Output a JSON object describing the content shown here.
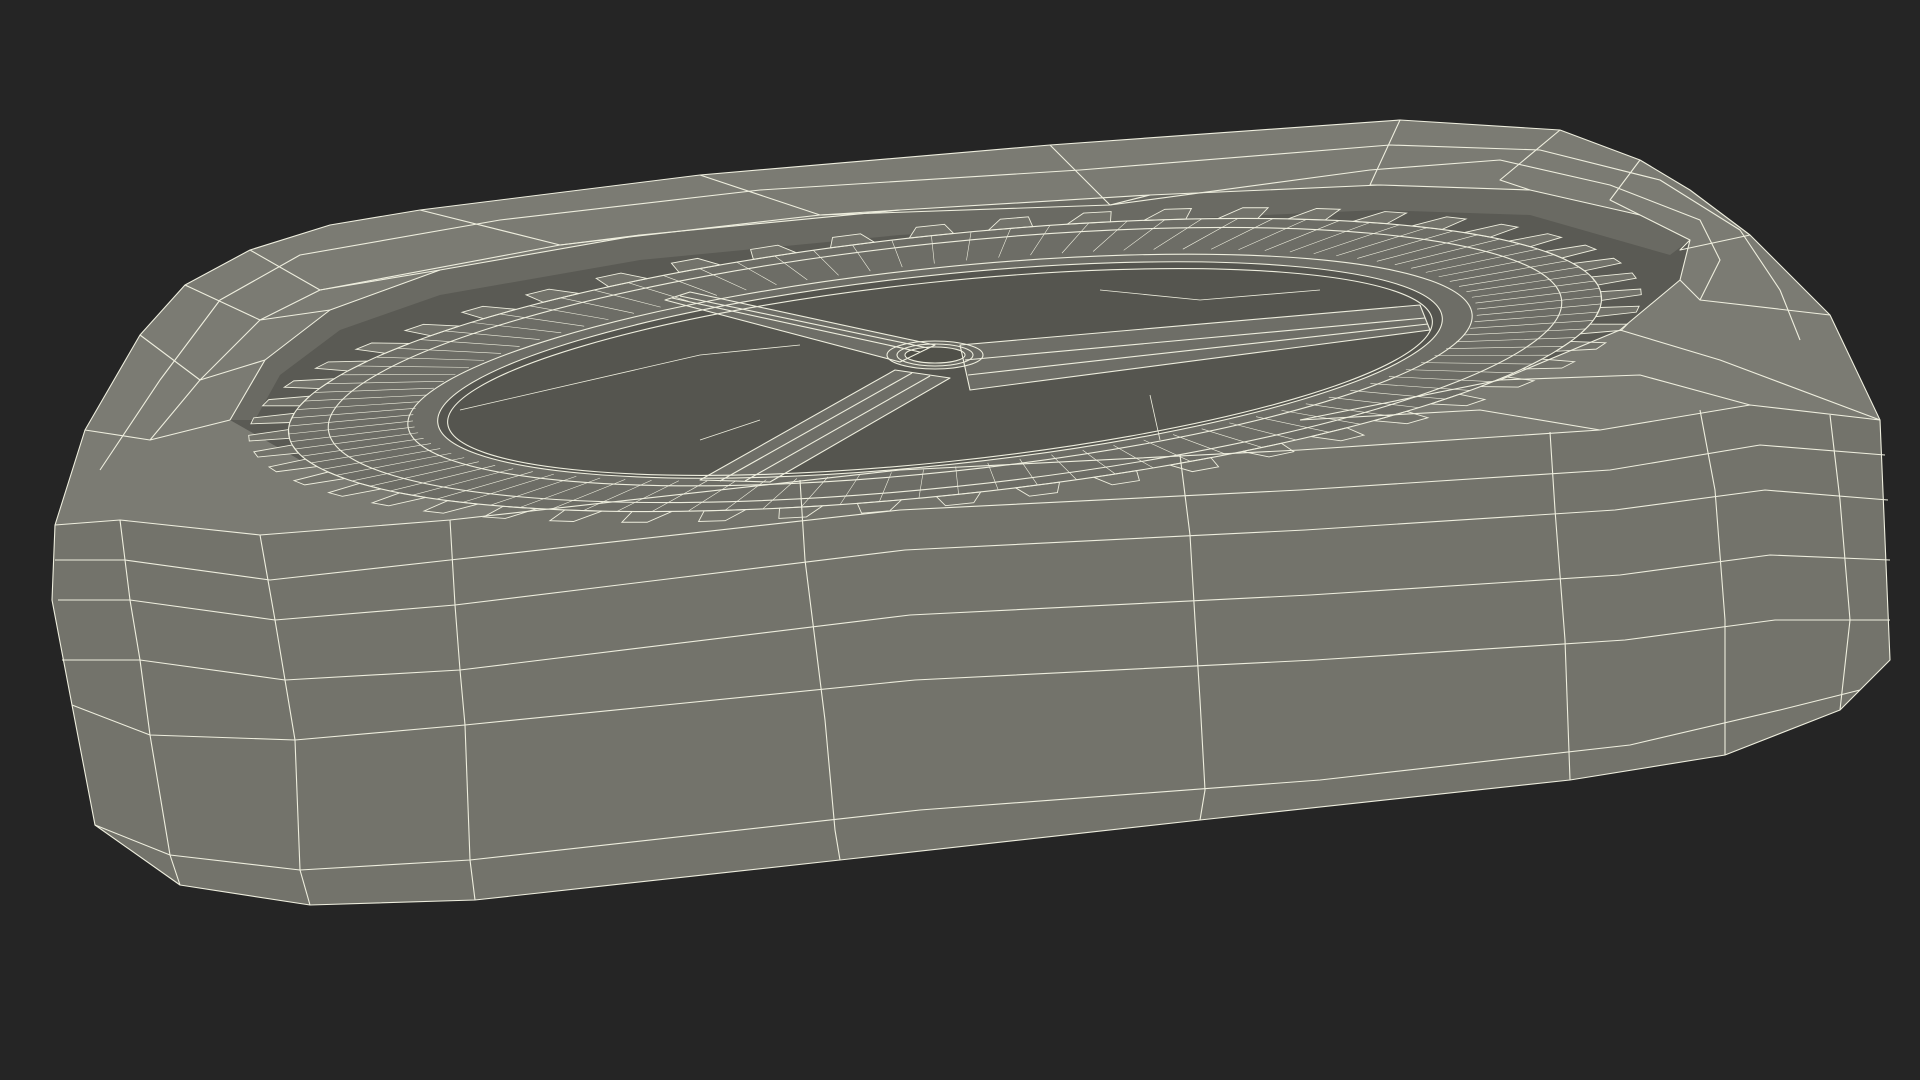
{
  "viewport": {
    "background_color": "#252525",
    "model_color": "#73736b",
    "model_shadow_color": "#5e5e57",
    "recess_color": "#5a5a54",
    "wireframe_color": "#eeeede",
    "render_mode": "wireframe-on-shaded"
  },
  "model": {
    "subject": "gear-icon",
    "gear_teeth_count": 52,
    "spoke_count": 3
  }
}
